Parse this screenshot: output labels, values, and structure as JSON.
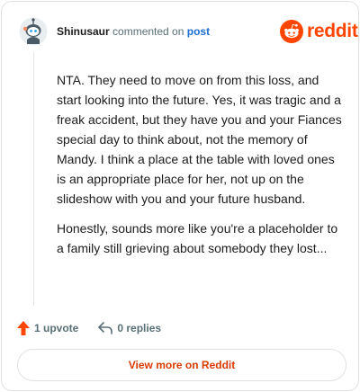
{
  "header": {
    "username": "Shinusaur",
    "action_text": "commented on",
    "post_link": "post",
    "brand_name": "reddit"
  },
  "comment": {
    "paragraphs": [
      "NTA. They need to move on from this loss, and start looking into the future. Yes, it was tragic and a freak accident, but they have you and your Fiances special day to think about, not the memory of Mandy. I think a place at the table with loved ones is an appropriate place for her, not up on the slideshow with you and your future husband.",
      "Honestly, sounds more like you're a placeholder to a family still grieving about somebody they lost..."
    ]
  },
  "actions": {
    "upvotes_label": "1 upvote",
    "replies_label": "0 replies"
  },
  "footer": {
    "view_more_label": "View more on Reddit"
  },
  "icons": {
    "upvote": "upvote-arrow-icon",
    "reply": "reply-arrow-icon",
    "brand": "reddit-snoo-icon",
    "avatar": "user-avatar-icon"
  },
  "colors": {
    "brand": "#ff4500",
    "link": "#1a6fd1",
    "muted": "#576f76",
    "view_more": "#d93a00"
  }
}
